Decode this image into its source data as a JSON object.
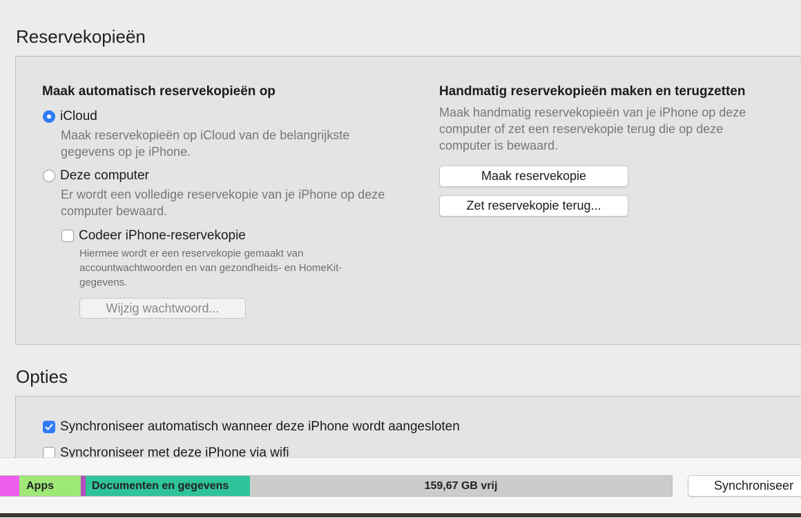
{
  "backups": {
    "title": "Reservekopieën",
    "auto": {
      "heading": "Maak automatisch reservekopieën op",
      "icloud_label": "iCloud",
      "icloud_desc_line1": "Maak reservekopieën op iCloud van de belangrijkste",
      "icloud_desc_line2": "gegevens op je iPhone.",
      "computer_label": "Deze computer",
      "computer_desc_line1": "Er wordt een volledige reservekopie van je iPhone op deze",
      "computer_desc_line2": "computer bewaard.",
      "encrypt_label": "Codeer iPhone-reservekopie",
      "encrypt_desc_line1": "Hiermee wordt er een reservekopie gemaakt van",
      "encrypt_desc_line2": "accountwachtwoorden en van gezondheids- en HomeKit-",
      "encrypt_desc_line3": "gegevens.",
      "change_password_button": "Wijzig wachtwoord...",
      "selected": "iCloud",
      "encrypt_checked": false
    },
    "manual": {
      "heading": "Handmatig reservekopieën maken en terugzetten",
      "desc_line1": "Maak handmatig reservekopieën van je iPhone op deze",
      "desc_line2": "computer of zet een reservekopie terug die op deze",
      "desc_line3": "computer is bewaard.",
      "backup_button": "Maak reservekopie",
      "restore_button": "Zet reservekopie terug..."
    }
  },
  "options": {
    "title": "Opties",
    "items": [
      {
        "label": "Synchroniseer automatisch wanneer deze iPhone wordt aangesloten",
        "checked": true
      },
      {
        "label": "Synchroniseer met deze iPhone via wifi",
        "checked": false
      }
    ]
  },
  "storage_bar": {
    "segments": [
      {
        "label": "",
        "color": "#f05ef0"
      },
      {
        "label": "Apps",
        "color": "#9ee878"
      },
      {
        "label": "",
        "color": "#b44fbf"
      },
      {
        "label": "Documenten en gegevens",
        "color": "#2fc39a"
      },
      {
        "label": "159,67 GB vrij",
        "color": "#cccccc"
      }
    ]
  },
  "sync_button": "Synchroniseer",
  "colors": {
    "accent": "#2f7cf6",
    "panel_bg": "#e4e4e4",
    "window_bg": "#ececec"
  }
}
